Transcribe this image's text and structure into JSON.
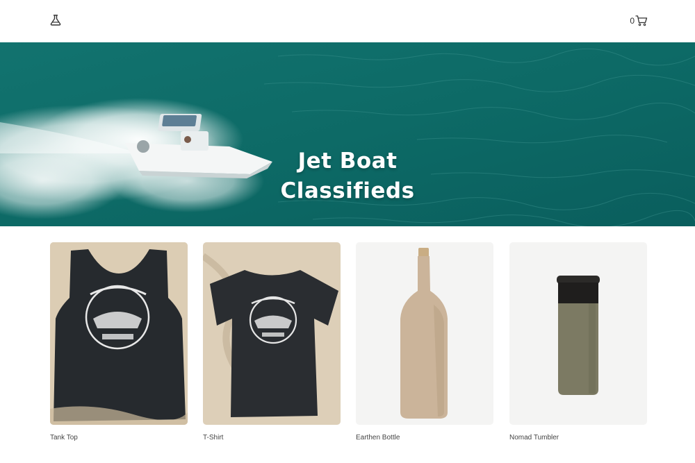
{
  "header": {
    "logo_icon": "flask-icon",
    "cart_icon": "cart-icon",
    "cart_count": "0"
  },
  "hero": {
    "title_line1": "Jet Boat",
    "title_line2": "Classifieds",
    "water_color": "#0e6a68"
  },
  "products": [
    {
      "title": "Tank Top"
    },
    {
      "title": "T-Shirt"
    },
    {
      "title": "Earthen Bottle"
    },
    {
      "title": "Nomad Tumbler"
    }
  ]
}
